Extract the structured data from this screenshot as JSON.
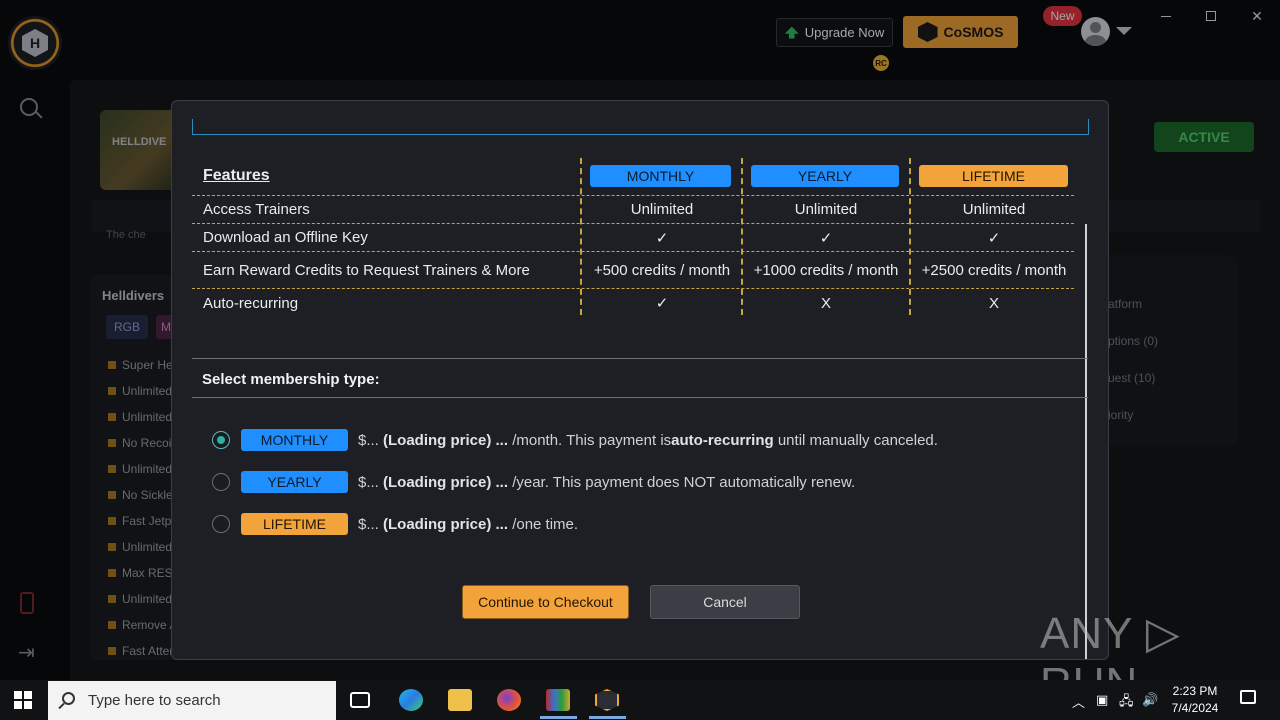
{
  "app": {
    "upgrade_label": "Upgrade Now",
    "cosmos_label": "CoSMOS",
    "rc_badge": "RC",
    "new_badge": "New",
    "logo_letter": "H",
    "colors": {
      "accent_orange": "#f2a33a",
      "accent_blue": "#1f8fff",
      "active_green": "#55d06b"
    }
  },
  "background": {
    "game_banner_text": "HELLDIVE",
    "active_label": "ACTIVE",
    "stripe_text": "The che",
    "cheat_list_title": "Helldivers",
    "tags": [
      "RGB",
      "M"
    ],
    "cheats": [
      "Super He",
      "Unlimited",
      "Unlimited",
      "No Recoil",
      "Unlimited",
      "No Sickle",
      "Fast Jetpa",
      "Unlimited",
      "Max RES",
      "Unlimited",
      "Remove A",
      "Fast Atten"
    ],
    "right_panel_items": [
      "atform",
      "ptions (0)",
      "uest (10)",
      "iority"
    ]
  },
  "modal": {
    "features": {
      "title": "Features",
      "plans": [
        {
          "label": "MONTHLY",
          "color": "blue"
        },
        {
          "label": "YEARLY",
          "color": "blue"
        },
        {
          "label": "LIFETIME",
          "color": "orange"
        }
      ],
      "rows": [
        {
          "label": "Access Trainers",
          "values": [
            "Unlimited",
            "Unlimited",
            "Unlimited"
          ]
        },
        {
          "label": "Download an Offline Key",
          "values": [
            "✓",
            "✓",
            "✓"
          ]
        },
        {
          "label": "Earn Reward Credits to Request Trainers & More",
          "values": [
            "+500 credits / month",
            "+1000 credits / month",
            "+2500 credits / month"
          ]
        },
        {
          "label": "Auto-recurring",
          "values": [
            "✓",
            "X",
            "X"
          ]
        }
      ]
    },
    "select_title": "Select membership type:",
    "options": [
      {
        "label": "MONTHLY",
        "price_prefix": "$... ",
        "loading": "(Loading price) ...",
        "suffix_a": " /month. This payment is",
        "suffix_bold": "auto-recurring",
        "suffix_b": " until manually canceled.",
        "checked": true
      },
      {
        "label": "YEARLY",
        "price_prefix": "$... ",
        "loading": "(Loading price) ...",
        "suffix_a": " /year. This payment does NOT automatically renew.",
        "suffix_bold": "",
        "suffix_b": "",
        "checked": false
      },
      {
        "label": "LIFETIME",
        "price_prefix": "$... ",
        "loading": "(Loading price) ...",
        "suffix_a": " /one time.",
        "suffix_bold": "",
        "suffix_b": "",
        "checked": false
      }
    ],
    "continue_label": "Continue to Checkout",
    "cancel_label": "Cancel"
  },
  "watermark": "ANY ▷ RUN",
  "taskbar": {
    "search_placeholder": "Type here to search",
    "time": "2:23 PM",
    "date": "7/4/2024"
  }
}
